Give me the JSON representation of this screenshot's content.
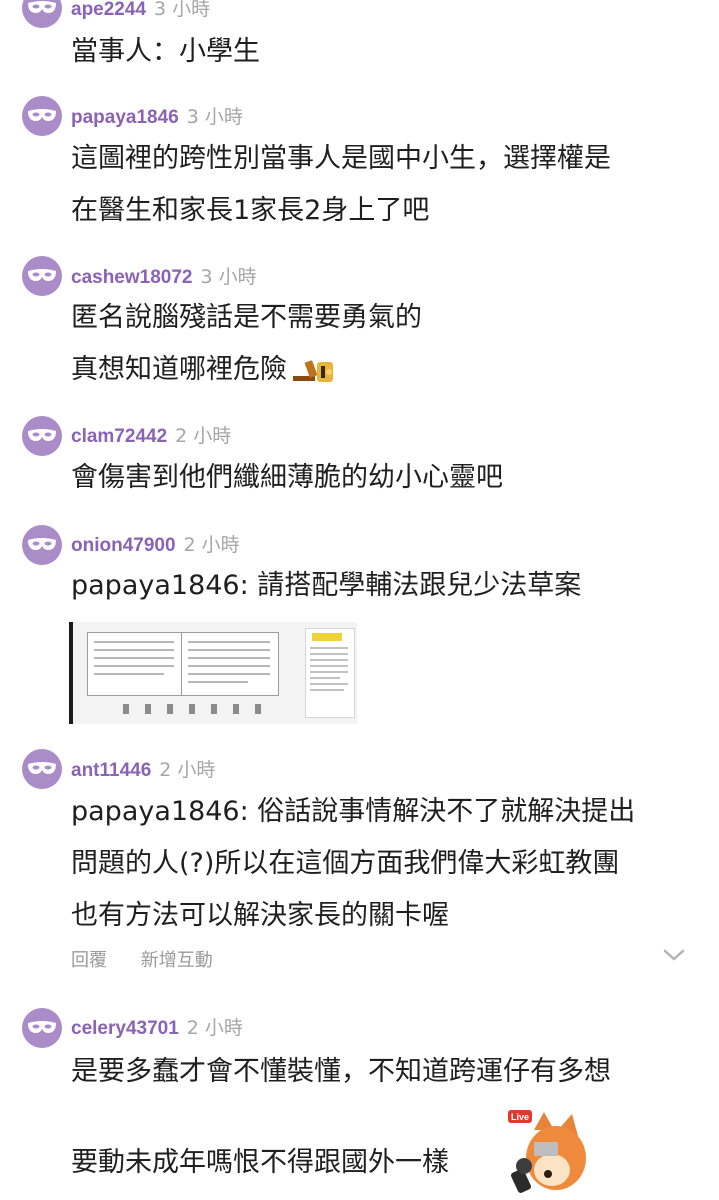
{
  "comments": [
    {
      "username": "ape2244",
      "time": "3 小時",
      "lines": [
        "當事人：小學生"
      ]
    },
    {
      "username": "papaya1846",
      "time": "3 小時",
      "lines": [
        "這圖裡的跨性別當事人是國中小生，選擇權是",
        "在醫生和家長1家長2身上了吧"
      ]
    },
    {
      "username": "cashew18072",
      "time": "3 小時",
      "lines": [
        "匿名說腦殘話是不需要勇氣的",
        "真想知道哪裡危險"
      ]
    },
    {
      "username": "clam72442",
      "time": "2 小時",
      "lines": [
        "會傷害到他們纖細薄脆的幼小心靈吧"
      ]
    },
    {
      "username": "onion47900",
      "time": "2 小時",
      "lines": [
        "papaya1846: 請搭配學輔法跟兒少法草案"
      ]
    },
    {
      "username": "ant11446",
      "time": "2 小時",
      "lines": [
        "papaya1846: 俗話說事情解決不了就解決提出",
        "問題的人(?)所以在這個方面我們偉大彩虹教團",
        "也有方法可以解決家長的關卡喔"
      ],
      "actions": {
        "reply": "回覆",
        "add_interaction": "新增互動"
      }
    },
    {
      "username": "celery43701",
      "time": "2 小時",
      "lines": [
        "是要多蠢才會不懂裝懂，不知道跨運仔有多想",
        "",
        "要動未成年嗎恨不得跟國外一樣"
      ]
    }
  ],
  "sticker": {
    "badge": "Live"
  },
  "colors": {
    "username": "#8a62b6",
    "avatar": "#a98cc8",
    "time": "#a6a6a6",
    "text": "#1f1f1f"
  }
}
